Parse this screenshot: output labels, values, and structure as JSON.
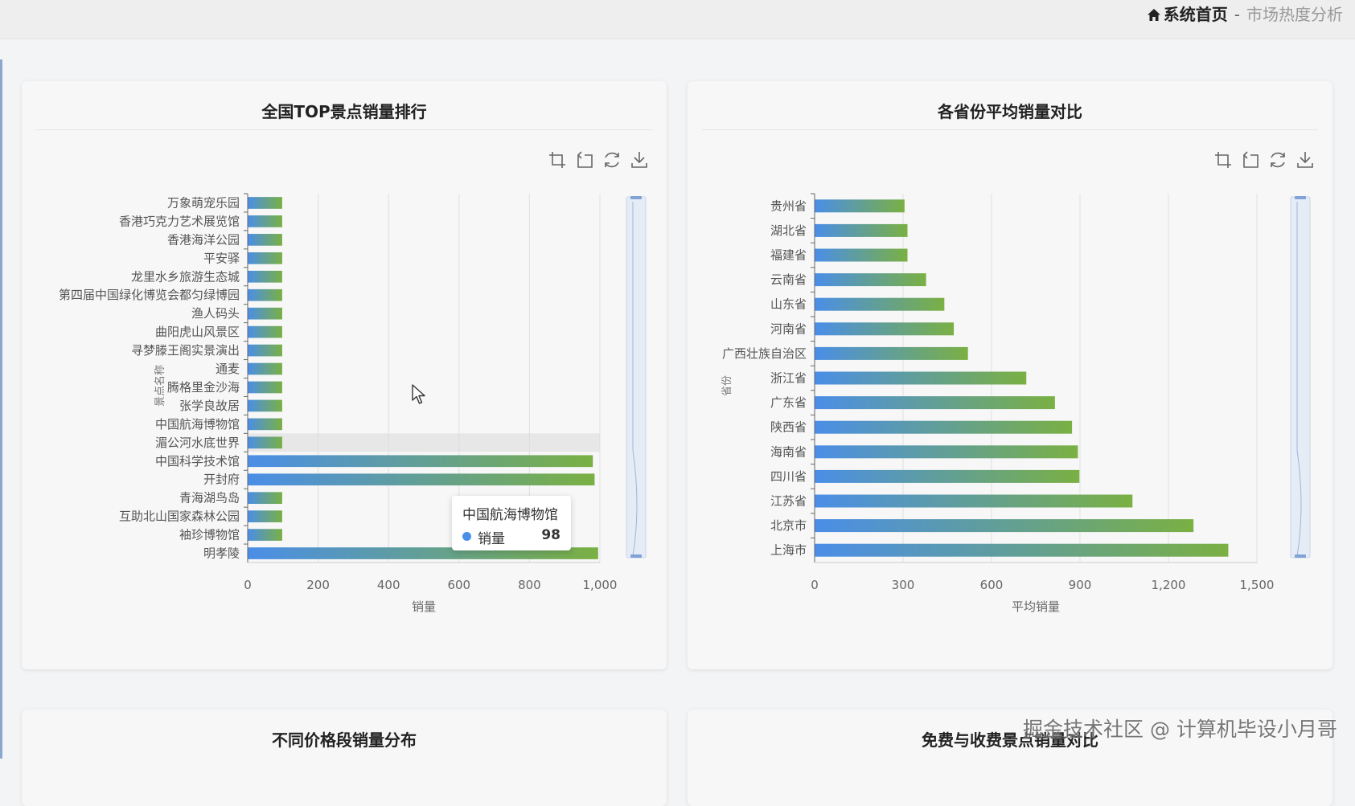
{
  "breadcrumb": {
    "home": "系统首页",
    "separator": "-",
    "current": "市场热度分析"
  },
  "cards": [
    {
      "title": "全国TOP景点销量排行"
    },
    {
      "title": "各省份平均销量对比"
    },
    {
      "title": "不同价格段销量分布"
    },
    {
      "title": "免费与收费景点销量对比"
    }
  ],
  "toolbox": [
    "zoom-select-icon",
    "zoom-reset-icon",
    "restore-icon",
    "download-icon"
  ],
  "tooltip": {
    "title": "中国航海博物馆",
    "series": "销量",
    "value": "98"
  },
  "watermark": "掘金技术社区 @ 计算机毕设小月哥",
  "colors": {
    "bar_start": "#4a8ee8",
    "bar_end": "#7ab043",
    "grid": "#e0e0e0",
    "axis": "#666666"
  },
  "chart_data": [
    {
      "type": "bar",
      "orientation": "horizontal",
      "title": "全国TOP景点销量排行",
      "xlabel": "销量",
      "ylabel": "景点名称",
      "xlim": [
        0,
        1000
      ],
      "xticks": [
        "0",
        "200",
        "400",
        "600",
        "800",
        "1,000"
      ],
      "categories": [
        "万象萌宠乐园",
        "香港巧克力艺术展览馆",
        "香港海洋公园",
        "平安驿",
        "龙里水乡旅游生态城",
        "第四届中国绿化博览会都匀绿博园",
        "渔人码头",
        "曲阳虎山风景区",
        "寻梦滕王阁实景演出",
        "通麦",
        "腾格里金沙海",
        "张学良故居",
        "中国航海博物馆",
        "湄公河水底世界",
        "中国科学技术馆",
        "开封府",
        "青海湖鸟岛",
        "互助北山国家森林公园",
        "袖珍博物馆",
        "明孝陵"
      ],
      "series": [
        {
          "name": "销量",
          "values": [
            98,
            98,
            98,
            98,
            98,
            98,
            98,
            98,
            98,
            98,
            98,
            98,
            98,
            98,
            980,
            985,
            98,
            98,
            98,
            995
          ]
        }
      ],
      "highlight": "湄公河水底世界",
      "grid": true,
      "datazoom": "right"
    },
    {
      "type": "bar",
      "orientation": "horizontal",
      "title": "各省份平均销量对比",
      "xlabel": "平均销量",
      "ylabel": "省份",
      "xlim": [
        0,
        1500
      ],
      "xticks": [
        "0",
        "300",
        "600",
        "900",
        "1,200",
        "1,500"
      ],
      "categories": [
        "贵州省",
        "湖北省",
        "福建省",
        "云南省",
        "山东省",
        "河南省",
        "广西壮族自治区",
        "浙江省",
        "广东省",
        "陕西省",
        "海南省",
        "四川省",
        "江苏省",
        "北京市",
        "上海市"
      ],
      "series": [
        {
          "name": "平均销量",
          "values": [
            305,
            315,
            315,
            378,
            440,
            472,
            520,
            718,
            815,
            873,
            893,
            898,
            1078,
            1285,
            1403
          ]
        }
      ],
      "grid": true,
      "datazoom": "right"
    }
  ]
}
